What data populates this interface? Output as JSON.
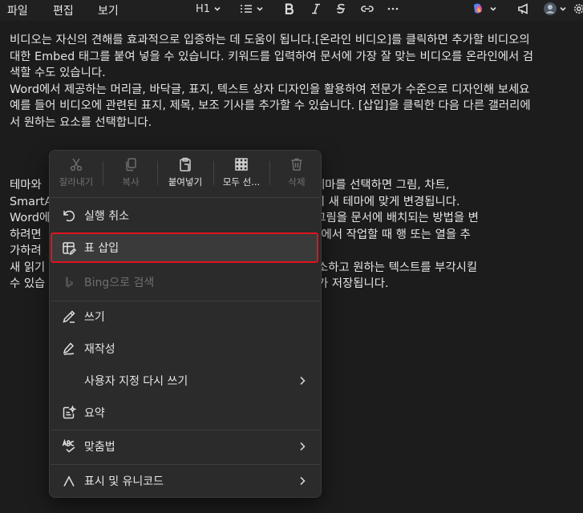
{
  "menubar": {
    "file": "파일",
    "edit": "편집",
    "view": "보기"
  },
  "toolbar": {
    "heading": "H1"
  },
  "document": {
    "lines": [
      "비디오는 자신의 견해를 효과적으로 입증하는 데 도움이 됩니다.[온라인 비디오]를 클릭하면 추가할 비디오의",
      "대한 Embed 태그를 붙여 넣을 수 있습니다. 키워드를 입력하여 문서에 가장 잘 맞는 비디오를 온라인에서 검",
      "색할 수도 있습니다.",
      "Word에서 제공하는 머리글, 바닥글, 표지, 텍스트 상자 디자인을 활용하여 전문가 수준으로 디자인해 보세요",
      "예를 들어 비디오에 관련된 표지, 제목, 보조 기사를 추가할 수 있습니다. [삽입]을 클릭한 다음 다른 갤러리에",
      "서 원하는 요소를 선택합니다.",
      "테마와                                                      을 클릭하고 새 테마를 선택하면 그림, 차트,",
      "SmartA                                                     적용하면 제목이 새 테마에 맞게 변경됩니다.",
      "Word에                                                     이 절약됩니다.그림을 문서에 배치되는 방법을 변",
      "하려면                                                     를 클릭하세요. 표에서 작업할 때 행 또는 열을 추",
      "가하려",
      "새 읽기                                                    문서의 일부를 축소하고 원하는 텍스트를 부각시킬",
      "수 있습                                                    서도 중지한 위치가 저장됩니다."
    ]
  },
  "context_menu": {
    "quick_actions": [
      {
        "label": "잘라내기",
        "icon": "scissors-icon",
        "enabled": false
      },
      {
        "label": "복사",
        "icon": "copy-icon",
        "enabled": false
      },
      {
        "label": "붙여넣기",
        "icon": "paste-icon",
        "enabled": true
      },
      {
        "label": "모두 선...",
        "icon": "select-all-icon",
        "enabled": true
      },
      {
        "label": "삭제",
        "icon": "trash-icon",
        "enabled": false
      }
    ],
    "items": {
      "undo": "실행 취소",
      "insert_table": "표 삽입",
      "bing_search": "Bing으로 검색",
      "write": "쓰기",
      "rewrite": "재작성",
      "custom_rewrite": "사용자 지정 다시 쓰기",
      "summary": "요약",
      "spelling": "맞춤법",
      "show_unicode": "표시 및 유니코드"
    }
  },
  "colors": {
    "background": "#1c1c1c",
    "menu_bg": "#2b2b2b",
    "highlight_border": "#e0141e"
  }
}
